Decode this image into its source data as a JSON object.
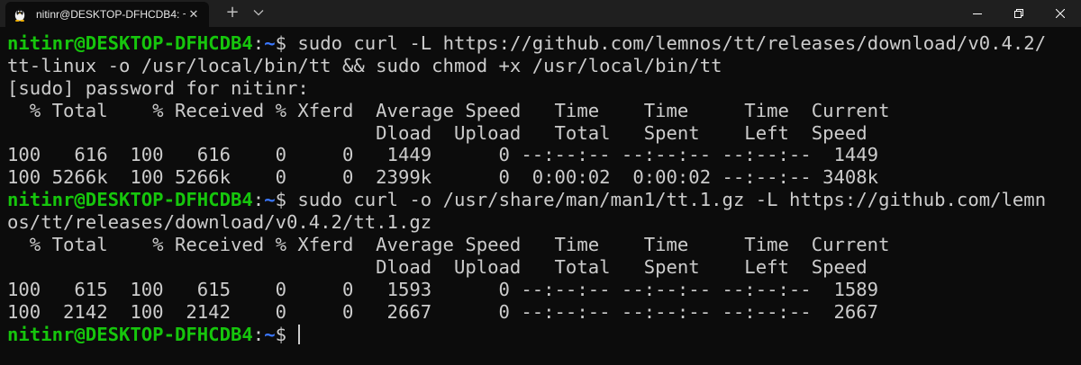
{
  "window": {
    "tab_title": "nitinr@DESKTOP-DFHCDB4: ~",
    "tab_icon": "linux-tux-icon",
    "new_tab_label": "+"
  },
  "colors": {
    "background": "#0c0c0c",
    "text": "#cccccc",
    "prompt_user": "#16c60c",
    "prompt_path": "#3b78ff"
  },
  "terminal": {
    "prompt": {
      "user_host": "nitinr@DESKTOP-DFHCDB4",
      "sep": ":",
      "path": "~",
      "symbol": "$ "
    },
    "lines": [
      {
        "type": "prompt",
        "cmd": "sudo curl -L https://github.com/lemnos/tt/releases/download/v0.4.2/"
      },
      {
        "type": "output",
        "text": "tt-linux -o /usr/local/bin/tt && sudo chmod +x /usr/local/bin/tt"
      },
      {
        "type": "output",
        "text": "[sudo] password for nitinr:"
      },
      {
        "type": "output",
        "text": "  % Total    % Received % Xferd  Average Speed   Time    Time     Time  Current"
      },
      {
        "type": "output",
        "text": "                                 Dload  Upload   Total   Spent    Left  Speed"
      },
      {
        "type": "output",
        "text": "100   616  100   616    0     0   1449      0 --:--:-- --:--:-- --:--:--  1449"
      },
      {
        "type": "output",
        "text": "100 5266k  100 5266k    0     0  2399k      0  0:00:02  0:00:02 --:--:-- 3408k"
      },
      {
        "type": "prompt",
        "cmd": "sudo curl -o /usr/share/man/man1/tt.1.gz -L https://github.com/lemn"
      },
      {
        "type": "output",
        "text": "os/tt/releases/download/v0.4.2/tt.1.gz"
      },
      {
        "type": "output",
        "text": "  % Total    % Received % Xferd  Average Speed   Time    Time     Time  Current"
      },
      {
        "type": "output",
        "text": "                                 Dload  Upload   Total   Spent    Left  Speed"
      },
      {
        "type": "output",
        "text": "100   615  100   615    0     0   1593      0 --:--:-- --:--:-- --:--:--  1589"
      },
      {
        "type": "output",
        "text": "100  2142  100  2142    0     0   2667      0 --:--:-- --:--:-- --:--:--  2667"
      },
      {
        "type": "prompt",
        "cmd": "",
        "cursor": true
      }
    ]
  }
}
